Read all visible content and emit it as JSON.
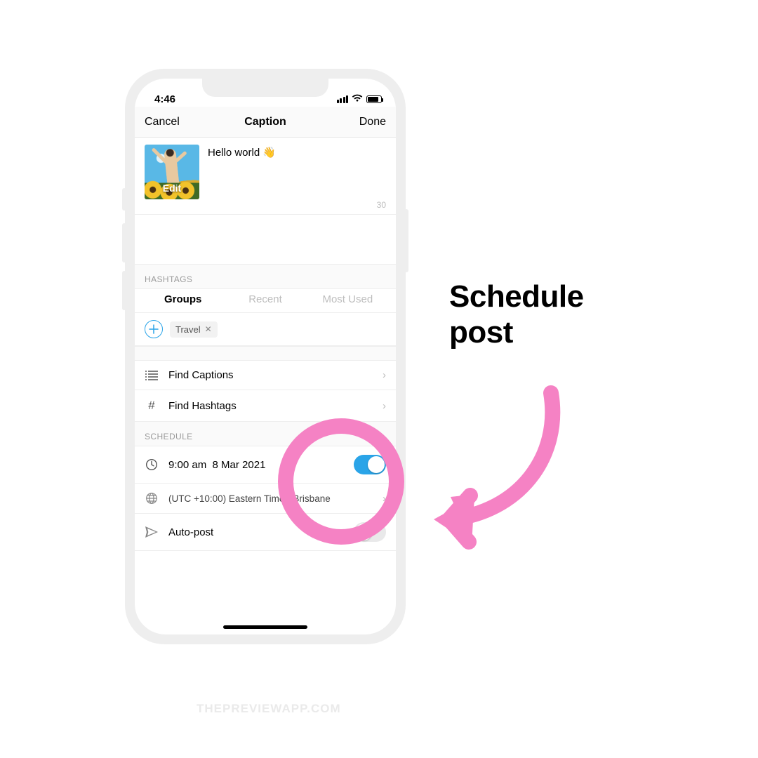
{
  "status": {
    "time": "4:46"
  },
  "nav": {
    "cancel": "Cancel",
    "title": "Caption",
    "done": "Done"
  },
  "caption": {
    "text": "Hello world 👋",
    "edit": "Edit",
    "counter": "30"
  },
  "hashtags": {
    "label": "HASHTAGS",
    "tabs": {
      "groups": "Groups",
      "recent": "Recent",
      "most_used": "Most Used"
    },
    "chip": {
      "label": "Travel"
    }
  },
  "rows": {
    "find_captions": "Find Captions",
    "find_hashtags": "Find Hashtags"
  },
  "schedule": {
    "label": "SCHEDULE",
    "time": "9:00 am",
    "date": "8 Mar 2021",
    "timezone": "(UTC +10:00) Eastern Time - Brisbane",
    "autopost": "Auto-post"
  },
  "callout": {
    "line1": "Schedule",
    "line2": "post"
  },
  "watermark": "THEPREVIEWAPP.COM"
}
